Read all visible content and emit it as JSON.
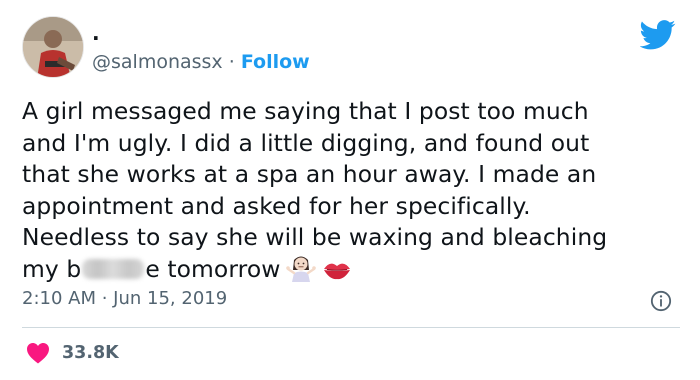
{
  "header": {
    "display_name": ".",
    "handle": "@salmonassx",
    "separator": " · ",
    "follow_label": "Follow",
    "twitter_icon": "twitter-bird-icon"
  },
  "tweet": {
    "lines": [
      "A girl messaged me saying that I post too much",
      "and I'm ugly. I did a little digging, and found out",
      "that she works at a spa an hour away. I made an",
      "appointment and asked for her specifically.",
      "Needless to say she will be waxing and bleaching"
    ],
    "last_line_before": "my b",
    "last_line_after": "e tomorrow",
    "emojis": [
      "woman-shrugging-emoji",
      "kiss-mark-emoji"
    ]
  },
  "meta": {
    "time": "2:10 AM",
    "separator": " · ",
    "date": "Jun 15, 2019"
  },
  "engagement": {
    "like_count": "33.8K"
  },
  "colors": {
    "brand": "#1d9bf0",
    "heart": "#f91880",
    "muted": "#536471"
  }
}
